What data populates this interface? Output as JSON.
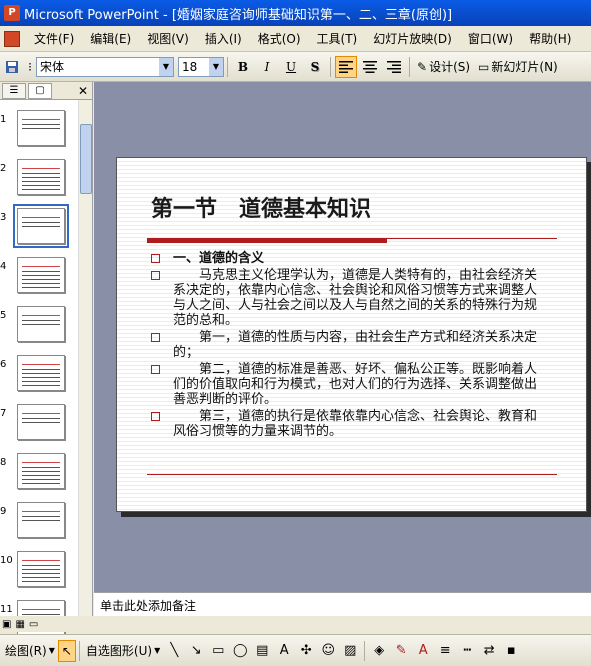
{
  "window": {
    "title": "Microsoft PowerPoint - [婚姻家庭咨询师基础知识第一、二、三章(原创)]"
  },
  "menu": [
    "文件(F)",
    "编辑(E)",
    "视图(V)",
    "插入(I)",
    "格式(O)",
    "工具(T)",
    "幻灯片放映(D)",
    "窗口(W)",
    "帮助(H)"
  ],
  "toolbar": {
    "font_name": "宋体",
    "font_size": "18",
    "bold": "B",
    "italic": "I",
    "underline": "U",
    "shadow": "S",
    "design_label": "设计(S)",
    "new_slide_label": "新幻灯片(N)"
  },
  "thumbnails": {
    "numbers": [
      "1",
      "2",
      "3",
      "4",
      "5",
      "6",
      "7",
      "8",
      "9",
      "10",
      "11"
    ],
    "selected": "3"
  },
  "slide": {
    "title": "第一节　道德基本知识",
    "bullets": [
      {
        "bold_lead": "一、道德的含义",
        "text": ""
      },
      {
        "bold_lead": "",
        "text": "　　马克思主义伦理学认为，道德是人类特有的，由社会经济关系决定的，依靠内心信念、社会舆论和风俗习惯等方式来调整人与人之间、人与社会之间以及人与自然之间的关系的特殊行为规范的总和。"
      },
      {
        "bold_lead": "",
        "text": "　　第一，道德的性质与内容，由社会生产方式和经济关系决定的；"
      },
      {
        "bold_lead": "",
        "text": "　　第二，道德的标准是善恶、好坏、偏私公正等。既影响着人们的价值取向和行为模式，也对人们的行为选择、关系调整做出善恶判断的评价。"
      },
      {
        "bold_lead": "",
        "text": "　　第三，道德的执行是依靠依靠内心信念、社会舆论、教育和风俗习惯等的力量来调节的。"
      }
    ]
  },
  "notes": {
    "placeholder": "单击此处添加备注"
  },
  "drawbar": {
    "draw_label": "绘图(R)",
    "autoshapes_label": "自选图形(U)"
  },
  "colors": {
    "accent_red": "#b01b1b",
    "titlebar_blue": "#0a5ce6"
  }
}
